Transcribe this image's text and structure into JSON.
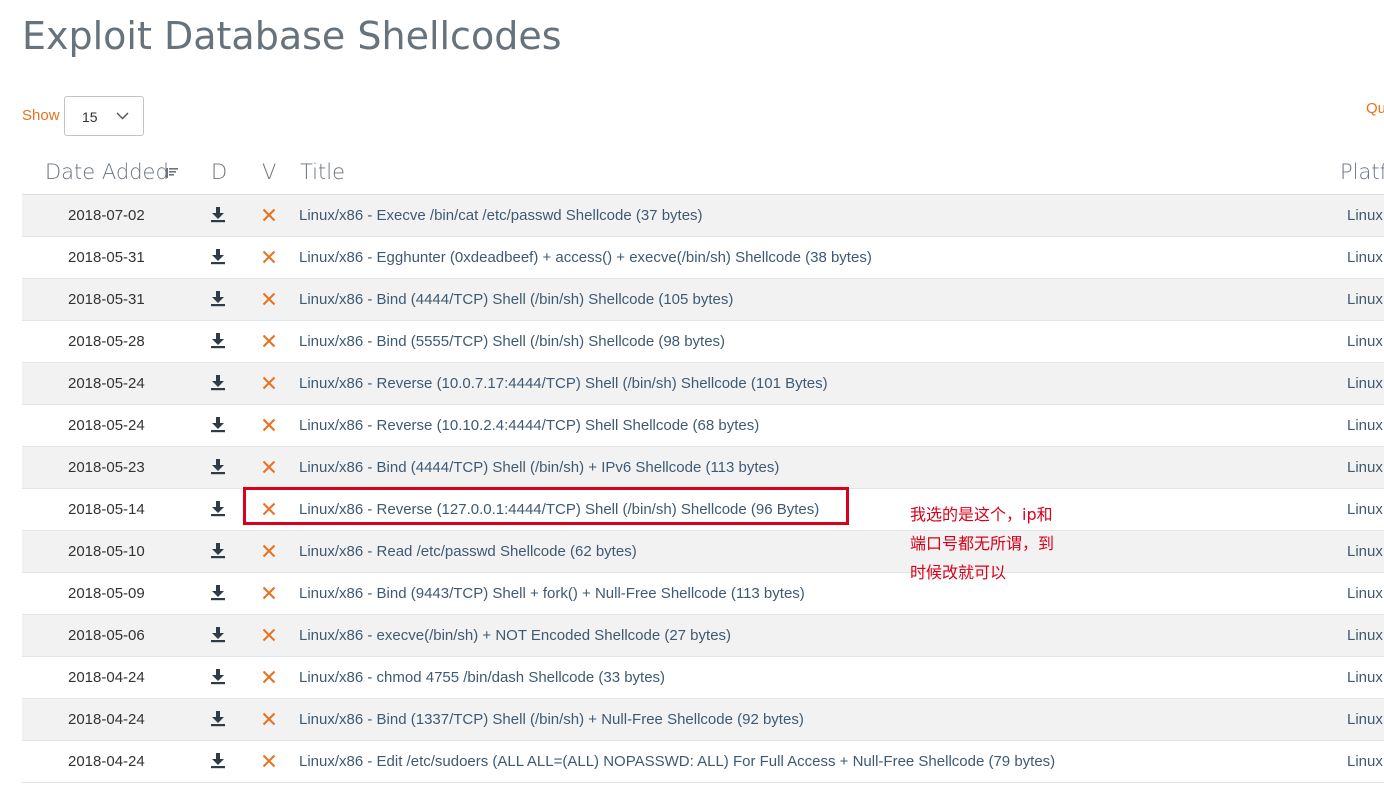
{
  "page": {
    "title": "Exploit Database Shellcodes"
  },
  "controls": {
    "show_label": "Show",
    "length_value": "15",
    "quick_search_label": "Qu"
  },
  "table": {
    "headers": {
      "date_added": "Date Added",
      "download": "D",
      "verified": "V",
      "title": "Title",
      "platform": "Platf"
    },
    "rows": [
      {
        "date": "2018-07-02",
        "title": "Linux/x86 - Execve /bin/cat /etc/passwd Shellcode (37 bytes)",
        "platform": "Linux"
      },
      {
        "date": "2018-05-31",
        "title": "Linux/x86 - Egghunter (0xdeadbeef) + access() + execve(/bin/sh) Shellcode (38 bytes)",
        "platform": "Linux"
      },
      {
        "date": "2018-05-31",
        "title": "Linux/x86 - Bind (4444/TCP) Shell (/bin/sh) Shellcode (105 bytes)",
        "platform": "Linux"
      },
      {
        "date": "2018-05-28",
        "title": "Linux/x86 - Bind (5555/TCP) Shell (/bin/sh) Shellcode (98 bytes)",
        "platform": "Linux"
      },
      {
        "date": "2018-05-24",
        "title": "Linux/x86 - Reverse (10.0.7.17:4444/TCP) Shell (/bin/sh) Shellcode (101 Bytes)",
        "platform": "Linux"
      },
      {
        "date": "2018-05-24",
        "title": "Linux/x86 - Reverse (10.10.2.4:4444/TCP) Shell Shellcode (68 bytes)",
        "platform": "Linux"
      },
      {
        "date": "2018-05-23",
        "title": "Linux/x86 - Bind (4444/TCP) Shell (/bin/sh) + IPv6 Shellcode (113 bytes)",
        "platform": "Linux"
      },
      {
        "date": "2018-05-14",
        "title": "Linux/x86 - Reverse (127.0.0.1:4444/TCP) Shell (/bin/sh) Shellcode (96 Bytes)",
        "platform": "Linux"
      },
      {
        "date": "2018-05-10",
        "title": "Linux/x86 - Read /etc/passwd Shellcode (62 bytes)",
        "platform": "Linux"
      },
      {
        "date": "2018-05-09",
        "title": "Linux/x86 - Bind (9443/TCP) Shell + fork() + Null-Free Shellcode (113 bytes)",
        "platform": "Linux"
      },
      {
        "date": "2018-05-06",
        "title": "Linux/x86 - execve(/bin/sh) + NOT Encoded Shellcode (27 bytes)",
        "platform": "Linux"
      },
      {
        "date": "2018-04-24",
        "title": "Linux/x86 - chmod 4755 /bin/dash Shellcode (33 bytes)",
        "platform": "Linux"
      },
      {
        "date": "2018-04-24",
        "title": "Linux/x86 - Bind (1337/TCP) Shell (/bin/sh) + Null-Free Shellcode (92 bytes)",
        "platform": "Linux"
      },
      {
        "date": "2018-04-24",
        "title": "Linux/x86 - Edit /etc/sudoers (ALL ALL=(ALL) NOPASSWD: ALL) For Full Access + Null-Free Shellcode (79 bytes)",
        "platform": "Linux"
      }
    ]
  },
  "annotation": {
    "lines": [
      "我选的是这个，ip和",
      "端口号都无所谓，到",
      "时候改就可以"
    ]
  },
  "colors": {
    "accent_orange": "#e8711f",
    "link_blue": "#3e5a73",
    "unverified_x": "#e8711f",
    "annotation_red": "#d9001b"
  },
  "icons": {
    "download": "download-icon",
    "unverified": "unverified-x-icon",
    "sort": "sort-icon",
    "dropdown": "chevron-down-icon"
  }
}
